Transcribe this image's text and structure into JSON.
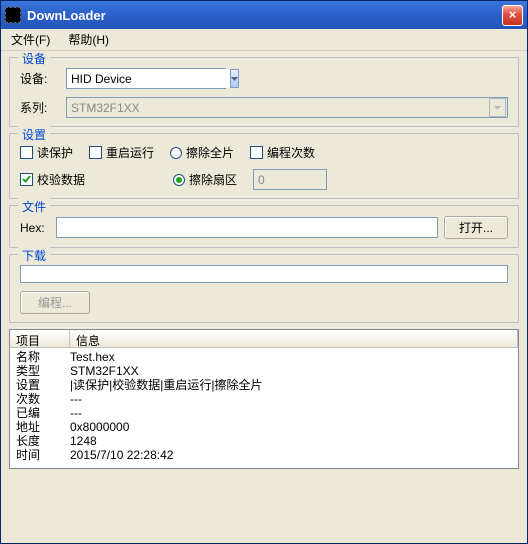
{
  "window": {
    "title": "DownLoader"
  },
  "menu": {
    "file": "文件(F)",
    "help": "帮助(H)"
  },
  "groups": {
    "device": "设备",
    "settings": "设置",
    "file": "文件",
    "download": "下载"
  },
  "device": {
    "device_label": "设备:",
    "device_value": "HID Device",
    "series_label": "系列:",
    "series_value": "STM32F1XX"
  },
  "settings": {
    "read_protect": "读保护",
    "restart_run": "重启运行",
    "erase_all": "擦除全片",
    "prog_count": "编程次数",
    "verify_data": "校验数据",
    "erase_sector": "擦除扇区",
    "count_value": "0"
  },
  "file": {
    "hex_label": "Hex:",
    "hex_value": "",
    "open_btn": "打开..."
  },
  "download": {
    "program_btn": "编程..."
  },
  "info": {
    "header_item": "项目",
    "header_info": "信息",
    "rows": [
      {
        "k": "名称",
        "v": "Test.hex"
      },
      {
        "k": "类型",
        "v": "STM32F1XX"
      },
      {
        "k": "设置",
        "v": "|读保护|校验数据|重启运行|擦除全片"
      },
      {
        "k": "次数",
        "v": "---"
      },
      {
        "k": "已编",
        "v": "---"
      },
      {
        "k": "地址",
        "v": "0x8000000"
      },
      {
        "k": "长度",
        "v": "1248"
      },
      {
        "k": "时间",
        "v": "2015/7/10 22:28:42"
      }
    ]
  }
}
